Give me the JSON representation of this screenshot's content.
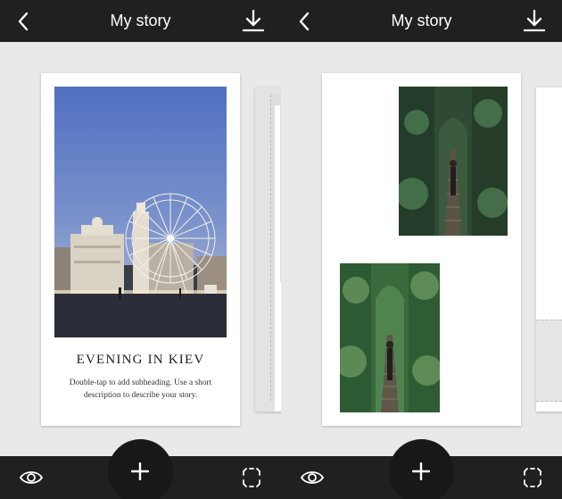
{
  "screens": [
    {
      "header": {
        "title": "My story",
        "back_icon": "chevron-left-icon",
        "download_icon": "download-icon"
      },
      "story_card": {
        "photo": "Ferris wheel at dusk, Kiev",
        "heading": "EVENING IN KIEV",
        "description": "Double-tap to add subheading. Use a short description to describe your story."
      },
      "footer": {
        "preview_icon": "eye-icon",
        "add_icon": "plus-icon",
        "focus_icon": "focus-frame-icon"
      }
    },
    {
      "header": {
        "title": "My story",
        "back_icon": "chevron-left-icon",
        "download_icon": "download-icon"
      },
      "story_card": {
        "photos": [
          "Woman walking along green tunnel railway",
          "Woman walking along green tunnel railway"
        ]
      },
      "footer": {
        "preview_icon": "eye-icon",
        "add_icon": "plus-icon",
        "focus_icon": "focus-frame-icon"
      }
    }
  ],
  "colors": {
    "bar": "#1f2121",
    "background": "#e8e9e9",
    "card": "#ffffff",
    "button": "#181818"
  }
}
